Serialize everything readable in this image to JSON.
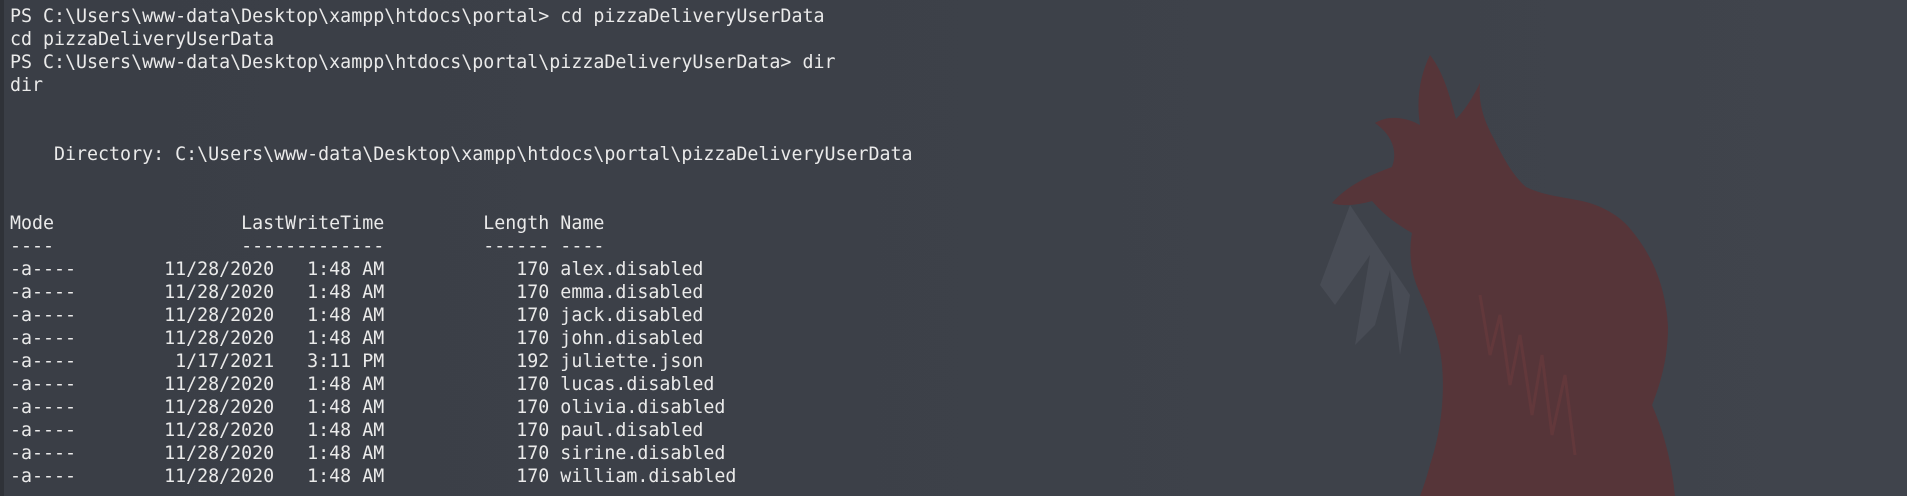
{
  "session": {
    "lines_top": [
      "PS C:\\Users\\www-data\\Desktop\\xampp\\htdocs\\portal> cd pizzaDeliveryUserData",
      "cd pizzaDeliveryUserData",
      "PS C:\\Users\\www-data\\Desktop\\xampp\\htdocs\\portal\\pizzaDeliveryUserData> dir",
      "dir"
    ],
    "directory_line": "    Directory: C:\\Users\\www-data\\Desktop\\xampp\\htdocs\\portal\\pizzaDeliveryUserData",
    "table_header": "Mode                 LastWriteTime         Length Name",
    "table_rule": "----                 -------------         ------ ----",
    "rows": [
      "-a----        11/28/2020   1:48 AM            170 alex.disabled",
      "-a----        11/28/2020   1:48 AM            170 emma.disabled",
      "-a----        11/28/2020   1:48 AM            170 jack.disabled",
      "-a----        11/28/2020   1:48 AM            170 john.disabled",
      "-a----         1/17/2021   3:11 PM            192 juliette.json",
      "-a----        11/28/2020   1:48 AM            170 lucas.disabled",
      "-a----        11/28/2020   1:48 AM            170 olivia.disabled",
      "-a----        11/28/2020   1:48 AM            170 paul.disabled",
      "-a----        11/28/2020   1:48 AM            170 sirine.disabled",
      "-a----        11/28/2020   1:48 AM            170 william.disabled"
    ]
  },
  "theme": {
    "background": "#3b3f47",
    "foreground": "#eaeaea",
    "wallpaper_fox": "#5a3336",
    "wallpaper_shadow": "#4b4f58"
  },
  "icons": {
    "wallpaper": "fox-wallpaper-icon"
  }
}
